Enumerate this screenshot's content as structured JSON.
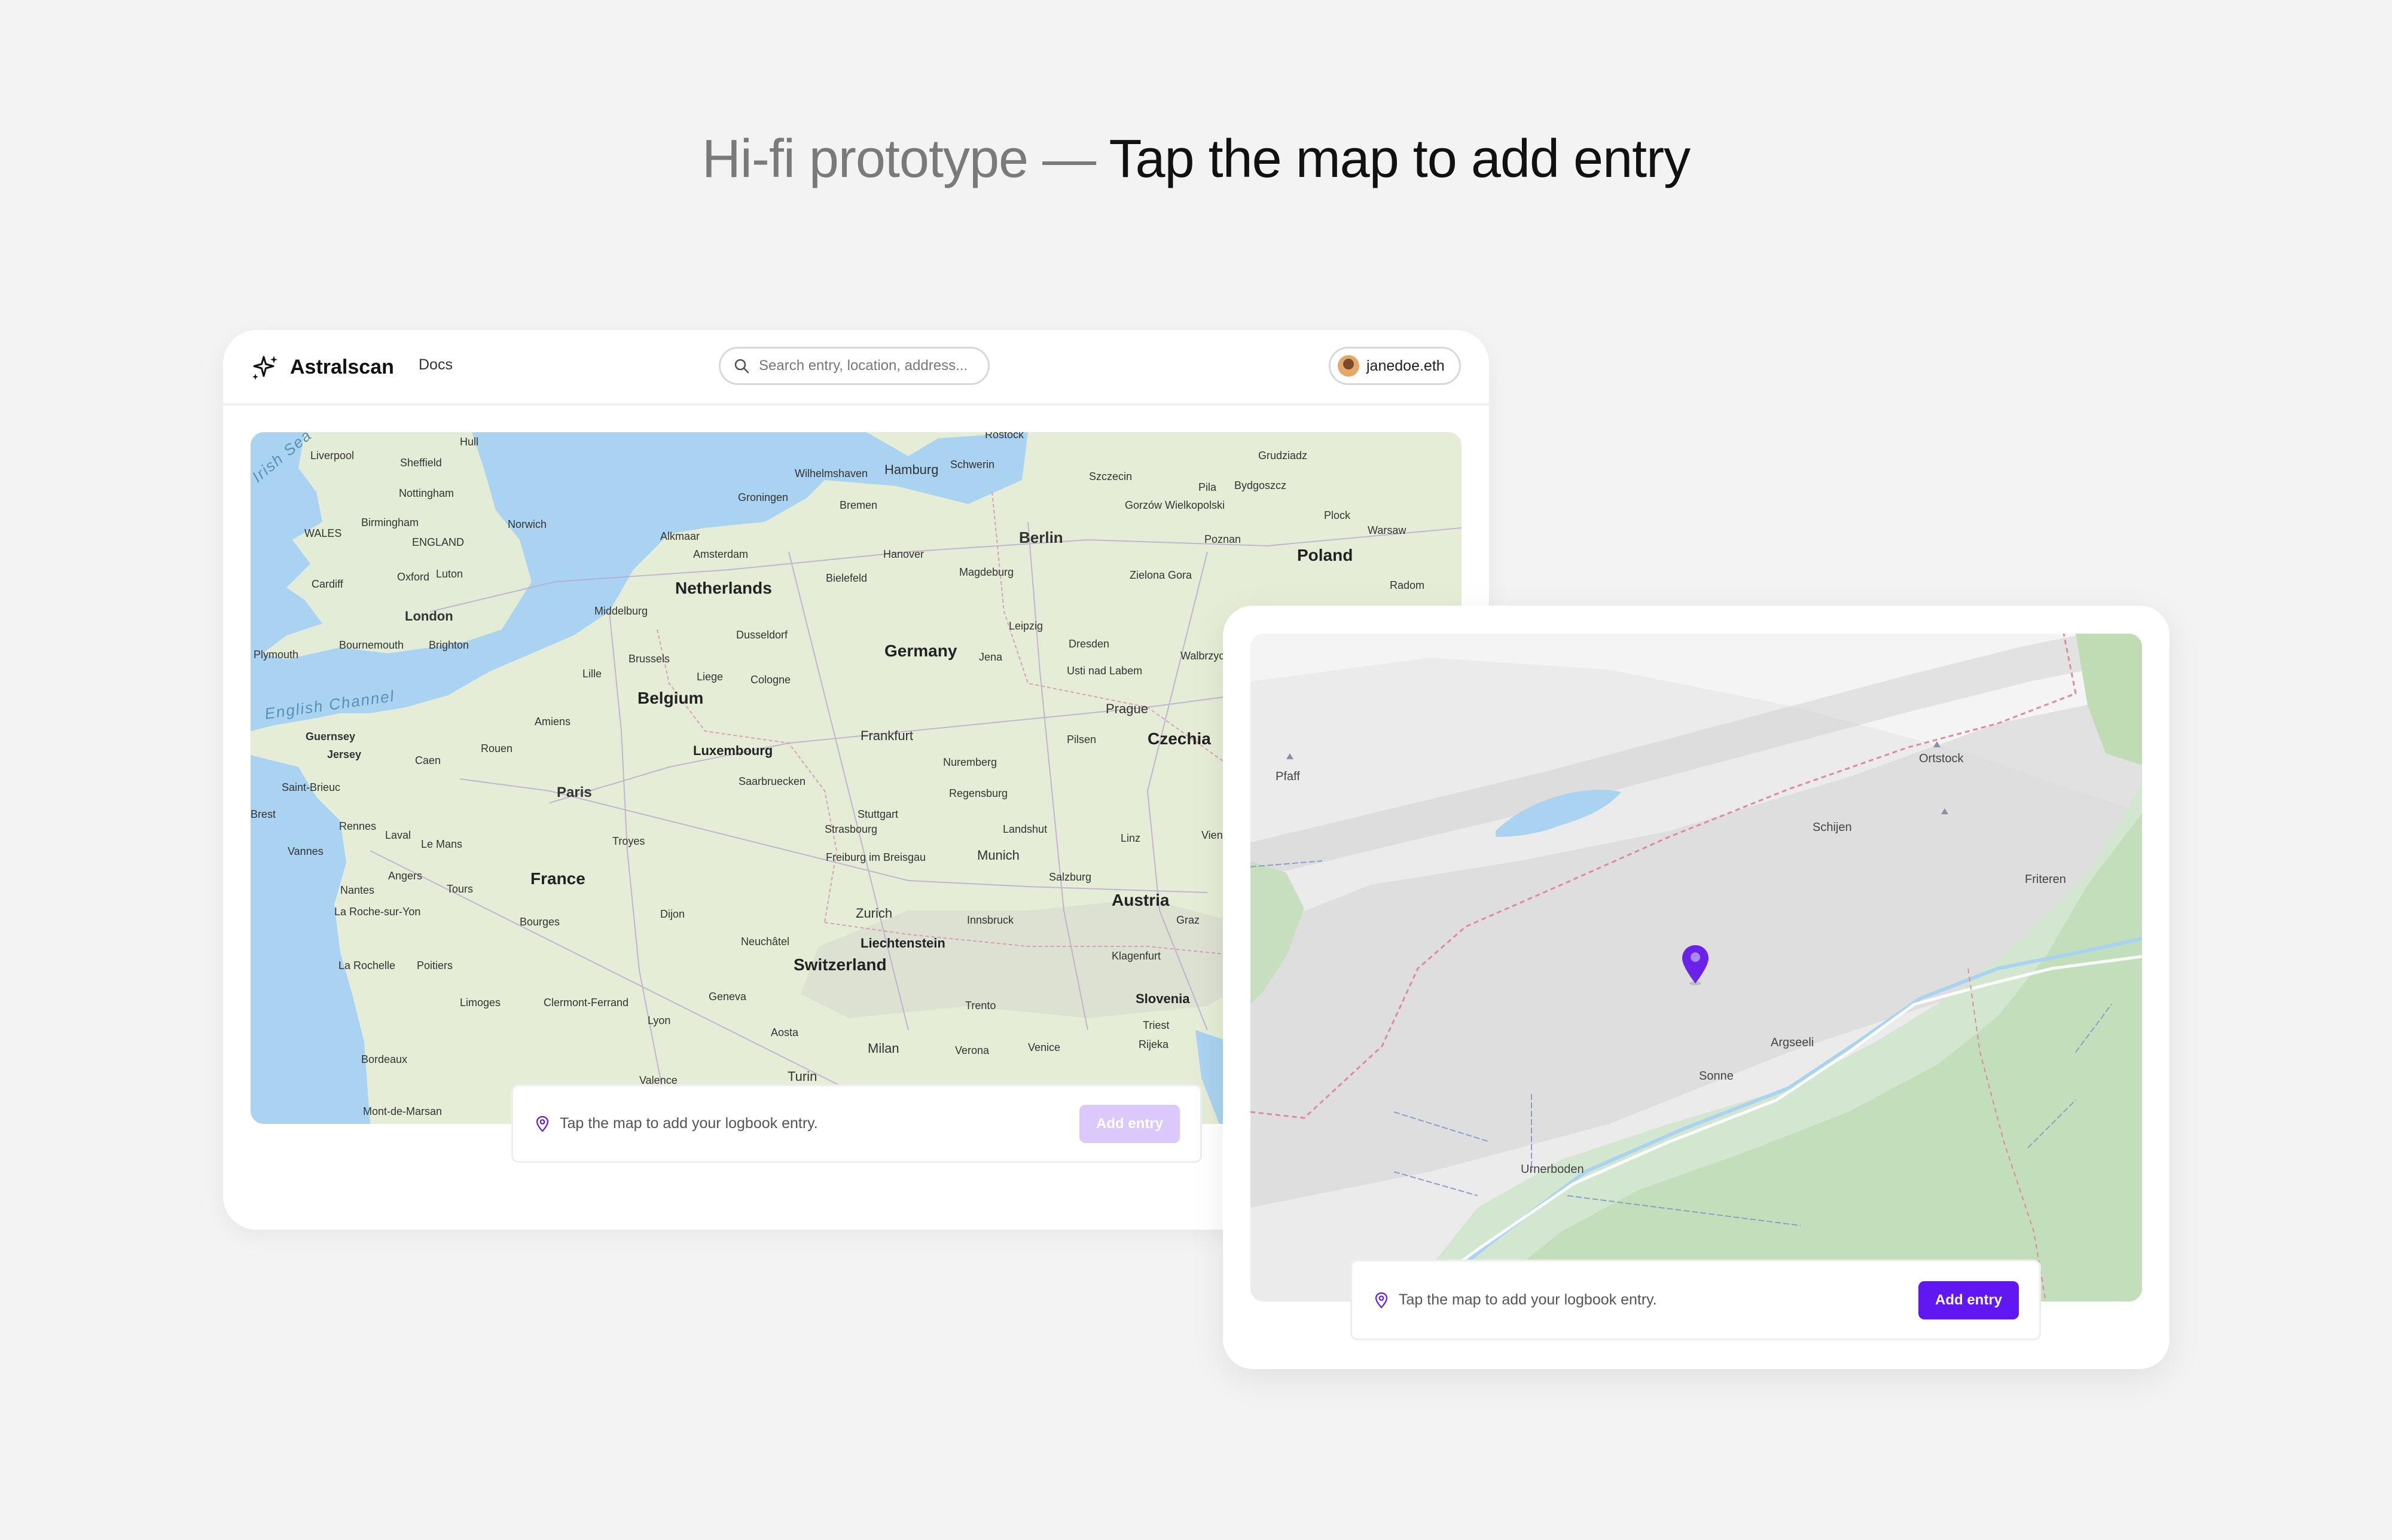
{
  "headline": {
    "prefix": "Hi-fi prototype — ",
    "emphasis": "Tap the map to add entry"
  },
  "colors": {
    "accent": "#6117f2",
    "accent_disabled": "#dcc9fb",
    "background": "#f3f3f3"
  },
  "desktop": {
    "app_name": "Astralscan",
    "logo_icon": "sparkles-icon",
    "nav": {
      "docs_label": "Docs"
    },
    "search": {
      "placeholder": "Search entry, location, address...",
      "value": ""
    },
    "user": {
      "username": "janedoe.eth",
      "avatar_icon": "avatar"
    },
    "map": {
      "seas": [
        "Irish Sea",
        "English Channel"
      ],
      "countries": [
        "Germany",
        "Poland",
        "Netherlands",
        "Belgium",
        "France",
        "Czechia",
        "Austria",
        "Switzerland",
        "Slovenia",
        "Liechtenstein",
        "Luxembourg"
      ],
      "cities": [
        "Hull",
        "Liverpool",
        "Sheffield",
        "Nottingham",
        "Birmingham",
        "WALES",
        "ENGLAND",
        "Norwich",
        "Cardiff",
        "Oxford",
        "Luton",
        "London",
        "Plymouth",
        "Bournemouth",
        "Brighton",
        "Guernsey",
        "Jersey",
        "Caen",
        "Rouen",
        "Amiens",
        "Lille",
        "Brussels",
        "Liege",
        "Cologne",
        "Dusseldorf",
        "Middelburg",
        "Alkmaar",
        "Amsterdam",
        "Groningen",
        "Wilhelmshaven",
        "Hamburg",
        "Schwerin",
        "Bremen",
        "Rostock",
        "Hanover",
        "Bielefeld",
        "Magdeburg",
        "Berlin",
        "Szczecin",
        "Gorzów Wielkopolski",
        "Pila",
        "Bydgoszcz",
        "Grudziadz",
        "Poznan",
        "Plock",
        "Warsaw",
        "Radom",
        "Zielona Gora",
        "Leipzig",
        "Dresden",
        "Jena",
        "Usti nad Labem",
        "Walbrzych",
        "Prague",
        "Pilsen",
        "Frankfurt",
        "Nuremberg",
        "Regensburg",
        "Saarbruecken",
        "Strasbourg",
        "Stuttgart",
        "Freiburg im Breisgau",
        "Munich",
        "Landshut",
        "Linz",
        "Vienna",
        "Salzburg",
        "Innsbruck",
        "Graz",
        "Zurich",
        "Neuchâtel",
        "Klagenfurt",
        "Geneva",
        "Trento",
        "Triest",
        "Rijeka",
        "Aosta",
        "Milan",
        "Verona",
        "Venice",
        "Turin",
        "Valence",
        "Lyon",
        "Clermont-Ferrand",
        "Limoges",
        "Poitiers",
        "La Rochelle",
        "La Roche-sur-Yon",
        "Nantes",
        "Vannes",
        "Rennes",
        "Saint-Brieuc",
        "Laval",
        "Le Mans",
        "Angers",
        "Tours",
        "Paris",
        "Troyes",
        "Dijon",
        "Bourges",
        "Bordeaux",
        "Mont-de-Marsan",
        "Brest"
      ]
    },
    "action_bar": {
      "pin_icon": "location-pin-icon",
      "hint": "Tap the map to add your logbook entry.",
      "button_label": "Add entry",
      "button_enabled": false
    }
  },
  "mobile": {
    "map": {
      "places": [
        "Pfaff",
        "Ortstock",
        "Schijen",
        "Friteren",
        "Argseeli",
        "Sonne",
        "Urnerboden"
      ],
      "marker_icon": "map-marker-icon"
    },
    "action_bar": {
      "pin_icon": "location-pin-icon",
      "hint": "Tap the map to add your logbook entry.",
      "button_label": "Add entry",
      "button_enabled": true
    }
  }
}
